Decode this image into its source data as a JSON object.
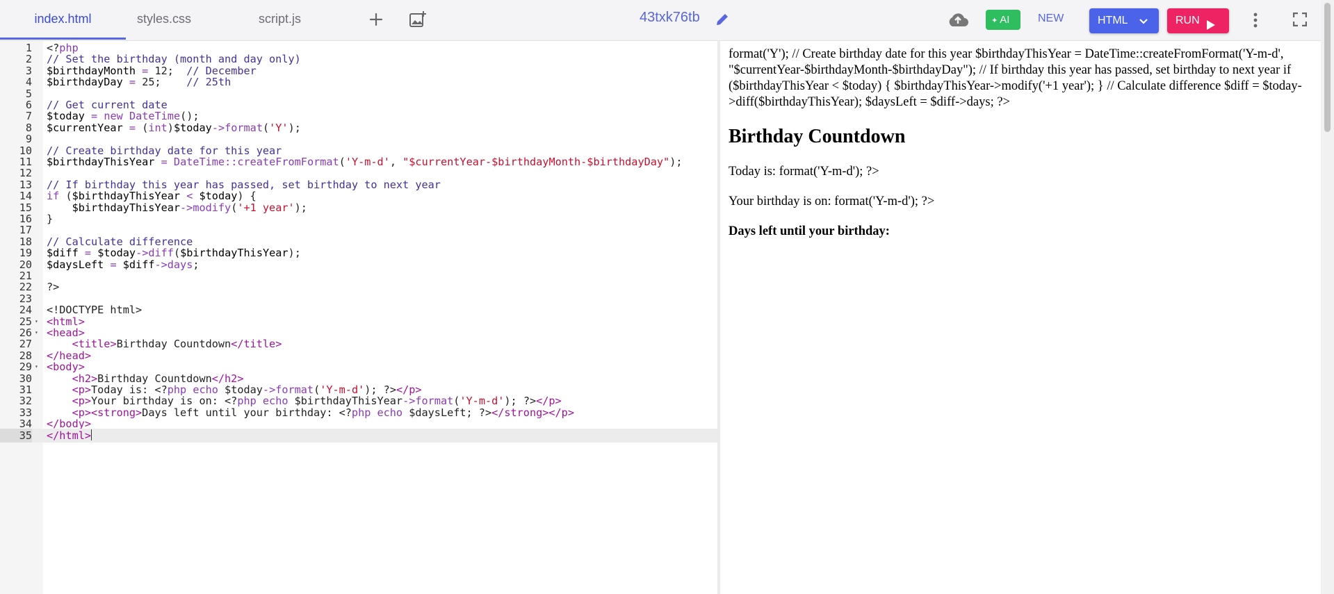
{
  "tabs": [
    {
      "label": "index.html"
    },
    {
      "label": "styles.css"
    },
    {
      "label": "script.js"
    }
  ],
  "project_name": "43txk76tb",
  "toolbar": {
    "ai_label": "AI",
    "new_label": "NEW",
    "language_label": "HTML",
    "run_label": "RUN"
  },
  "colors": {
    "accent": "#5866e0",
    "ai_green": "#2ebd5f",
    "html_button": "#4b63e8",
    "run_button": "#ee2363"
  },
  "editor": {
    "current_line": 35,
    "lines": [
      {
        "n": 1,
        "segs": [
          [
            "txt",
            "<?"
          ],
          [
            "kw",
            "php"
          ]
        ]
      },
      {
        "n": 2,
        "segs": [
          [
            "cm",
            "// Set the birthday (month and day only)"
          ]
        ]
      },
      {
        "n": 3,
        "segs": [
          [
            "var",
            "$birthdayMonth"
          ],
          [
            "txt",
            " "
          ],
          [
            "kw",
            "="
          ],
          [
            "txt",
            " 12;  "
          ],
          [
            "cm",
            "// December"
          ]
        ]
      },
      {
        "n": 4,
        "segs": [
          [
            "var",
            "$birthdayDay"
          ],
          [
            "txt",
            " "
          ],
          [
            "kw",
            "="
          ],
          [
            "txt",
            " 25;    "
          ],
          [
            "cm",
            "// 25th"
          ]
        ]
      },
      {
        "n": 5,
        "segs": []
      },
      {
        "n": 6,
        "segs": [
          [
            "cm",
            "// Get current date"
          ]
        ]
      },
      {
        "n": 7,
        "segs": [
          [
            "var",
            "$today"
          ],
          [
            "txt",
            " "
          ],
          [
            "kw",
            "="
          ],
          [
            "txt",
            " "
          ],
          [
            "kw",
            "new"
          ],
          [
            "txt",
            " "
          ],
          [
            "kw",
            "DateTime"
          ],
          [
            "txt",
            "();"
          ]
        ]
      },
      {
        "n": 8,
        "segs": [
          [
            "var",
            "$currentYear"
          ],
          [
            "txt",
            " "
          ],
          [
            "kw",
            "="
          ],
          [
            "txt",
            " ("
          ],
          [
            "kw",
            "int"
          ],
          [
            "txt",
            ")"
          ],
          [
            "var",
            "$today"
          ],
          [
            "kw",
            "->format"
          ],
          [
            "txt",
            "("
          ],
          [
            "str",
            "'Y'"
          ],
          [
            "txt",
            ");"
          ]
        ]
      },
      {
        "n": 9,
        "segs": []
      },
      {
        "n": 10,
        "segs": [
          [
            "cm",
            "// Create birthday date for this year"
          ]
        ]
      },
      {
        "n": 11,
        "segs": [
          [
            "var",
            "$birthdayThisYear"
          ],
          [
            "txt",
            " "
          ],
          [
            "kw",
            "="
          ],
          [
            "txt",
            " "
          ],
          [
            "kw",
            "DateTime::createFromFormat"
          ],
          [
            "txt",
            "("
          ],
          [
            "str",
            "'Y-m-d'"
          ],
          [
            "txt",
            ", "
          ],
          [
            "str",
            "\"$currentYear-$birthdayMonth-$birthdayDay\""
          ],
          [
            "txt",
            ");"
          ]
        ]
      },
      {
        "n": 12,
        "segs": []
      },
      {
        "n": 13,
        "segs": [
          [
            "cm",
            "// If birthday this year has passed, set birthday to next year"
          ]
        ]
      },
      {
        "n": 14,
        "segs": [
          [
            "kw",
            "if"
          ],
          [
            "txt",
            " ("
          ],
          [
            "var",
            "$birthdayThisYear"
          ],
          [
            "txt",
            " "
          ],
          [
            "kw",
            "<"
          ],
          [
            "txt",
            " "
          ],
          [
            "var",
            "$today"
          ],
          [
            "txt",
            ") {"
          ]
        ]
      },
      {
        "n": 15,
        "segs": [
          [
            "txt",
            "    "
          ],
          [
            "var",
            "$birthdayThisYear"
          ],
          [
            "kw",
            "->modify"
          ],
          [
            "txt",
            "("
          ],
          [
            "str",
            "'+1 year'"
          ],
          [
            "txt",
            ");"
          ]
        ]
      },
      {
        "n": 16,
        "segs": [
          [
            "txt",
            "}"
          ]
        ]
      },
      {
        "n": 17,
        "segs": []
      },
      {
        "n": 18,
        "segs": [
          [
            "cm",
            "// Calculate difference"
          ]
        ]
      },
      {
        "n": 19,
        "segs": [
          [
            "var",
            "$diff"
          ],
          [
            "txt",
            " "
          ],
          [
            "kw",
            "="
          ],
          [
            "txt",
            " "
          ],
          [
            "var",
            "$today"
          ],
          [
            "kw",
            "->diff"
          ],
          [
            "txt",
            "("
          ],
          [
            "var",
            "$birthdayThisYear"
          ],
          [
            "txt",
            ");"
          ]
        ]
      },
      {
        "n": 20,
        "segs": [
          [
            "var",
            "$daysLeft"
          ],
          [
            "txt",
            " "
          ],
          [
            "kw",
            "="
          ],
          [
            "txt",
            " "
          ],
          [
            "var",
            "$diff"
          ],
          [
            "kw",
            "->days"
          ],
          [
            "txt",
            ";"
          ]
        ]
      },
      {
        "n": 21,
        "segs": []
      },
      {
        "n": 22,
        "segs": [
          [
            "txt",
            "?>"
          ]
        ]
      },
      {
        "n": 23,
        "segs": []
      },
      {
        "n": 24,
        "segs": [
          [
            "txt",
            "<!DOCTYPE html>"
          ]
        ]
      },
      {
        "n": 25,
        "fold": true,
        "segs": [
          [
            "tag",
            "<html>"
          ]
        ]
      },
      {
        "n": 26,
        "fold": true,
        "segs": [
          [
            "tag",
            "<head>"
          ]
        ]
      },
      {
        "n": 27,
        "segs": [
          [
            "txt",
            "    "
          ],
          [
            "tag",
            "<title>"
          ],
          [
            "txt",
            "Birthday Countdown"
          ],
          [
            "tag",
            "</title>"
          ]
        ]
      },
      {
        "n": 28,
        "segs": [
          [
            "tag",
            "</head>"
          ]
        ]
      },
      {
        "n": 29,
        "fold": true,
        "segs": [
          [
            "tag",
            "<body>"
          ]
        ]
      },
      {
        "n": 30,
        "segs": [
          [
            "txt",
            "    "
          ],
          [
            "tag",
            "<h2>"
          ],
          [
            "txt",
            "Birthday Countdown"
          ],
          [
            "tag",
            "</h2>"
          ]
        ]
      },
      {
        "n": 31,
        "segs": [
          [
            "txt",
            "    "
          ],
          [
            "tag",
            "<p>"
          ],
          [
            "txt",
            "Today is: <?"
          ],
          [
            "kw",
            "php echo"
          ],
          [
            "txt",
            " $today"
          ],
          [
            "kw",
            "->format"
          ],
          [
            "txt",
            "("
          ],
          [
            "str",
            "'Y-m-d'"
          ],
          [
            "txt",
            "); ?>"
          ],
          [
            "tag",
            "</p>"
          ]
        ]
      },
      {
        "n": 32,
        "segs": [
          [
            "txt",
            "    "
          ],
          [
            "tag",
            "<p>"
          ],
          [
            "txt",
            "Your birthday is on: <?"
          ],
          [
            "kw",
            "php echo"
          ],
          [
            "txt",
            " $birthdayThisYear"
          ],
          [
            "kw",
            "->format"
          ],
          [
            "txt",
            "("
          ],
          [
            "str",
            "'Y-m-d'"
          ],
          [
            "txt",
            "); ?>"
          ],
          [
            "tag",
            "</p>"
          ]
        ]
      },
      {
        "n": 33,
        "segs": [
          [
            "txt",
            "    "
          ],
          [
            "tag",
            "<p><strong>"
          ],
          [
            "txt",
            "Days left until your birthday: <?"
          ],
          [
            "kw",
            "php echo"
          ],
          [
            "txt",
            " $daysLeft; ?>"
          ],
          [
            "tag",
            "</strong></p>"
          ]
        ]
      },
      {
        "n": 34,
        "segs": [
          [
            "tag",
            "</body>"
          ]
        ]
      },
      {
        "n": 35,
        "segs": [
          [
            "tag",
            "</html>"
          ]
        ]
      }
    ]
  },
  "preview": {
    "php_leak": "format('Y'); // Create birthday date for this year $birthdayThisYear = DateTime::createFromFormat('Y-m-d', \"$currentYear-$birthdayMonth-$birthdayDay\"); // If birthday this year has passed, set birthday to next year if ($birthdayThisYear < $today) { $birthdayThisYear->modify('+1 year'); } // Calculate difference $diff = $today->diff($birthdayThisYear); $daysLeft = $diff->days; ?>",
    "heading": "Birthday Countdown",
    "today_line": "Today is: format('Y-m-d'); ?>",
    "birthday_line": "Your birthday is on: format('Y-m-d'); ?>",
    "days_left_line": "Days left until your birthday:"
  }
}
